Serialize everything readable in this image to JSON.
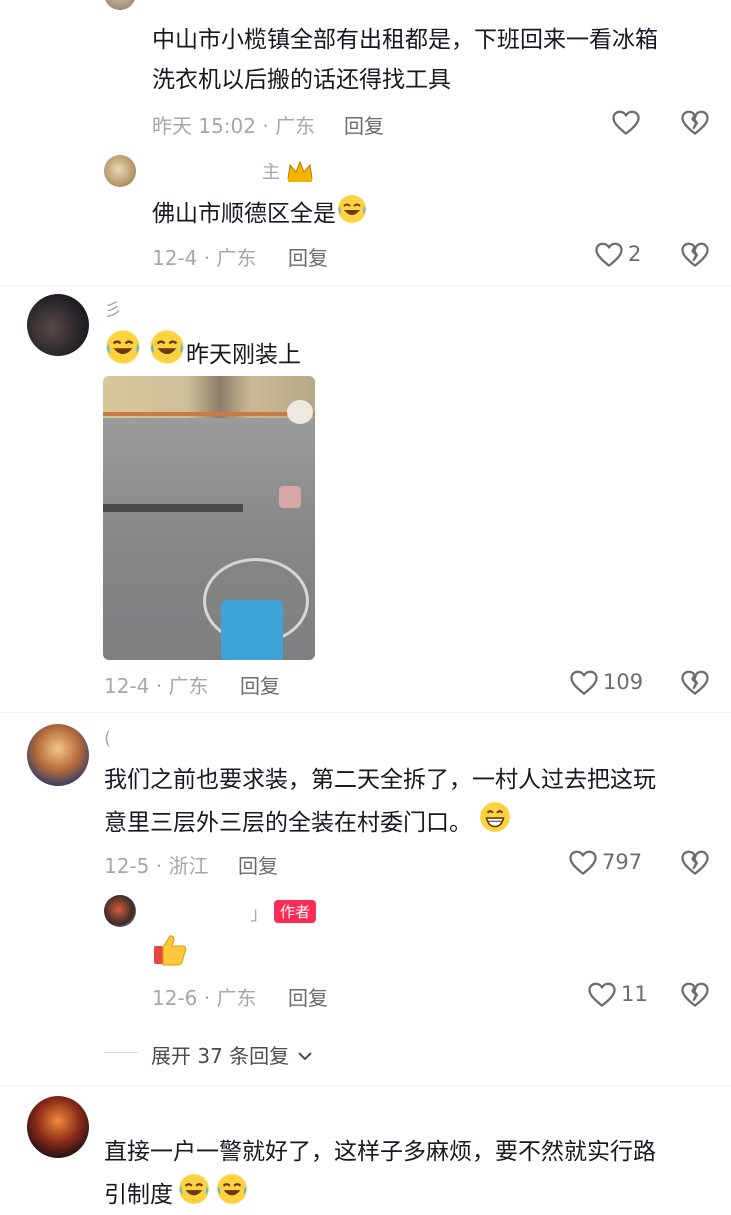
{
  "c1": {
    "text_line1": "中山市小榄镇全部有出租都是，下班回来一看冰箱",
    "text_line2": "洗衣机以后搬的话还得找工具",
    "meta": "昨天 15:02 · 广东",
    "reply": "回复"
  },
  "r1": {
    "name": "主",
    "text": "佛山市顺德区全是",
    "meta": "12-4 · 广东",
    "reply": "回复",
    "likes": "2"
  },
  "c2": {
    "name": "彡",
    "text": "昨天刚装上",
    "meta": "12-4 · 广东",
    "reply": "回复",
    "likes": "109"
  },
  "c3": {
    "name": "(",
    "text_line1": "我们之前也要求装，第二天全拆了，一村人过去把这玩",
    "text_line2": "意里三层外三层的全装在村委门口。",
    "meta": "12-5 · 浙江",
    "reply": "回复",
    "likes": "797"
  },
  "r3": {
    "name": "」",
    "author_badge": "作者",
    "meta": "12-6 · 广东",
    "reply": "回复",
    "likes": "11"
  },
  "expand": {
    "label": "展开 37 条回复"
  },
  "c4": {
    "text_line1": "直接一户一警就好了，这样子多麻烦，要不然就实行路",
    "text_line2": "引制度"
  },
  "colors": {
    "accent": "#fe2c55",
    "text": "#161823",
    "meta": "#a6a7ab",
    "icon": "#6b6c72"
  },
  "icons": [
    "heart-icon",
    "broken-heart-icon",
    "crown-icon",
    "laughing-emoji",
    "thumbs-up-emoji",
    "grin-emoji",
    "chevron-down-icon"
  ]
}
